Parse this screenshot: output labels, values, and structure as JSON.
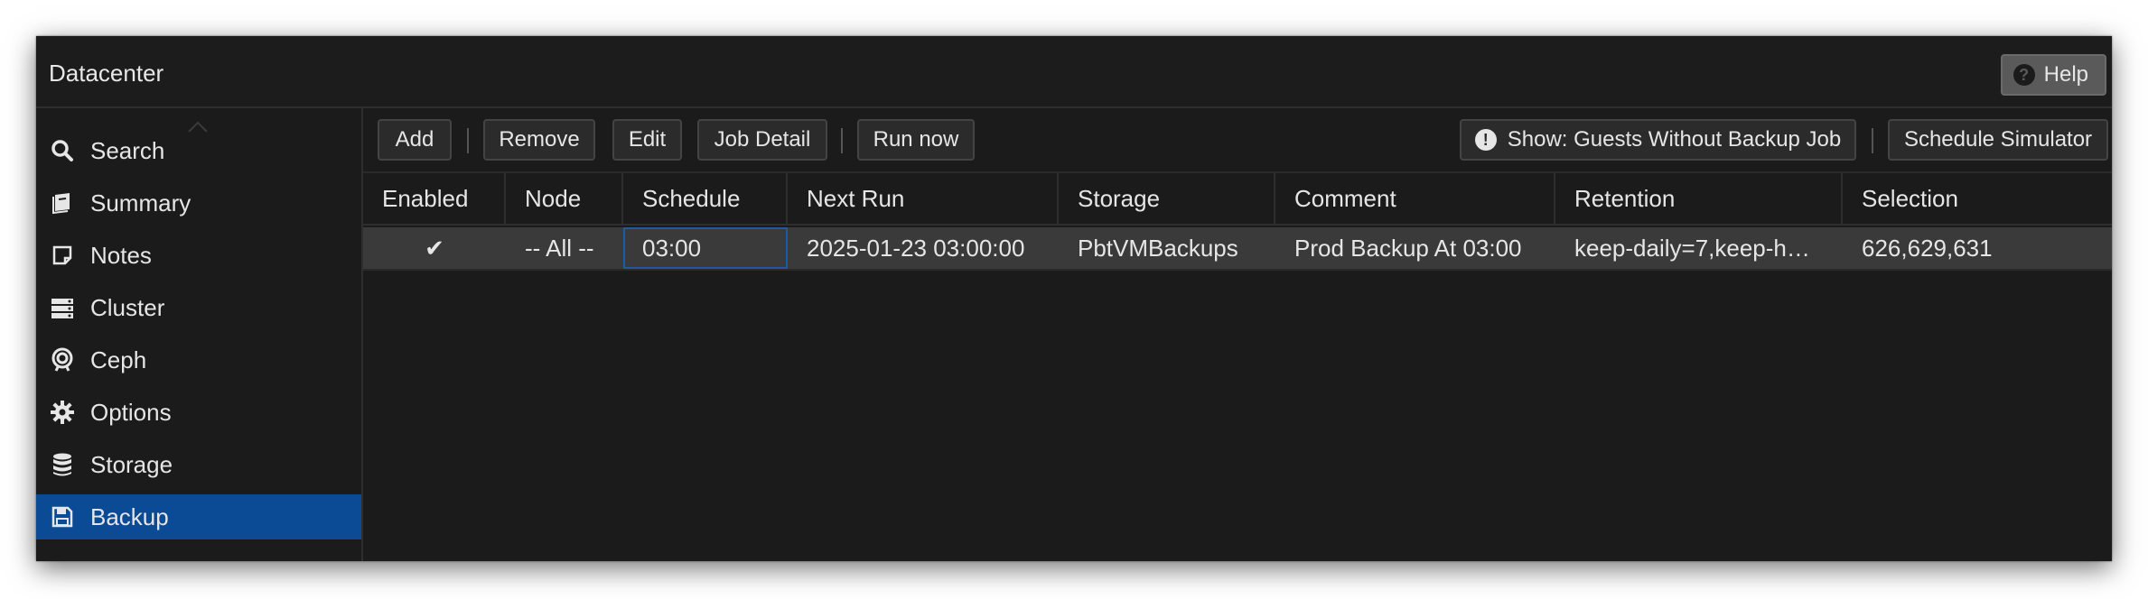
{
  "window": {
    "title": "Datacenter",
    "help_label": "Help"
  },
  "sidebar": {
    "items": [
      {
        "label": "Search",
        "icon": "search-icon"
      },
      {
        "label": "Summary",
        "icon": "book-icon"
      },
      {
        "label": "Notes",
        "icon": "sticky-note-icon"
      },
      {
        "label": "Cluster",
        "icon": "server-icon"
      },
      {
        "label": "Ceph",
        "icon": "ceph-icon"
      },
      {
        "label": "Options",
        "icon": "gear-icon"
      },
      {
        "label": "Storage",
        "icon": "database-icon"
      },
      {
        "label": "Backup",
        "icon": "floppy-disk-icon",
        "active": true
      }
    ]
  },
  "toolbar": {
    "add": "Add",
    "remove": "Remove",
    "edit": "Edit",
    "job_detail": "Job Detail",
    "run_now": "Run now",
    "show_guests": "Show: Guests Without Backup Job",
    "schedule_simulator": "Schedule Simulator"
  },
  "table": {
    "columns": [
      "Enabled",
      "Node",
      "Schedule",
      "Next Run",
      "Storage",
      "Comment",
      "Retention",
      "Selection"
    ],
    "rows": [
      {
        "enabled": "✔",
        "node": "-- All --",
        "schedule": "03:00",
        "next_run": "2025-01-23 03:00:00",
        "storage": "PbtVMBackups",
        "comment": "Prod Backup At 03:00",
        "retention": "keep-daily=7,keep-h…",
        "selection": "626,629,631"
      }
    ]
  },
  "colors": {
    "active_nav": "#0b4a94",
    "background": "#1b1b1b",
    "selected_row": "#3a3a3a"
  }
}
